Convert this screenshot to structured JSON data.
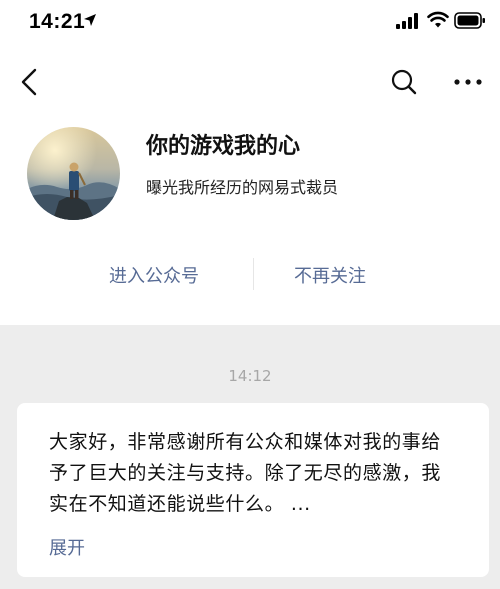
{
  "status_bar": {
    "time": "14:21"
  },
  "nav": {
    "icons": [
      "back-arrow-icon",
      "search-icon",
      "more-icon"
    ]
  },
  "profile": {
    "name": "你的游戏我的心",
    "description": "曝光我所经历的网易式裁员"
  },
  "actions": {
    "enter_label": "进入公众号",
    "unfollow_label": "不再关注"
  },
  "message": {
    "timestamp": "14:12",
    "text": "大家好，非常感谢所有公众和媒体对我的事给予了巨大的关注与支持。除了无尽的感激，我实在不知道还能说些什么。 ...",
    "expand_label": "展开"
  },
  "colors": {
    "link": "#576b95",
    "area_background": "#ededed",
    "timestamp": "#a7a7a7"
  }
}
